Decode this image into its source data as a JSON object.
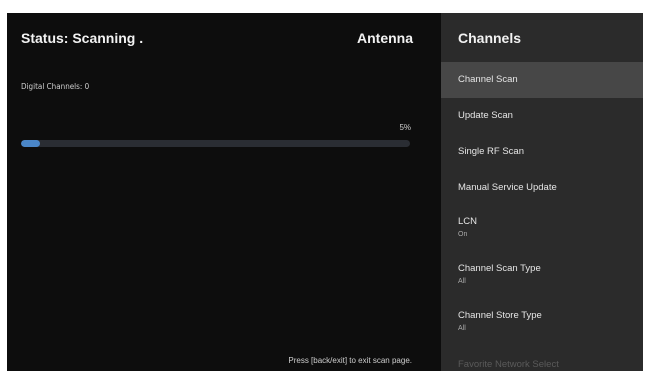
{
  "scan": {
    "status": "Status: Scanning .",
    "source": "Antenna",
    "channels_label": "Digital Channels: 0",
    "progress_text": "5%",
    "progress_value": 0.05,
    "exit_hint": "Press [back/exit] to exit scan page."
  },
  "panel": {
    "title": "Channels",
    "items": [
      {
        "label": "Channel Scan",
        "value": ""
      },
      {
        "label": "Update Scan",
        "value": ""
      },
      {
        "label": "Single RF Scan",
        "value": ""
      },
      {
        "label": "Manual Service Update",
        "value": ""
      },
      {
        "label": "LCN",
        "value": "On"
      },
      {
        "label": "Channel Scan Type",
        "value": "All"
      },
      {
        "label": "Channel Store Type",
        "value": "All"
      },
      {
        "label": "Favorite Network Select",
        "value": ""
      }
    ]
  },
  "colors": {
    "background": "#0d0d0d",
    "panel": "#2b2b2b",
    "selected": "#474747",
    "progress_track": "#2a2d33",
    "progress_fill": "#4a86c8",
    "text": "#f2f2f2"
  }
}
